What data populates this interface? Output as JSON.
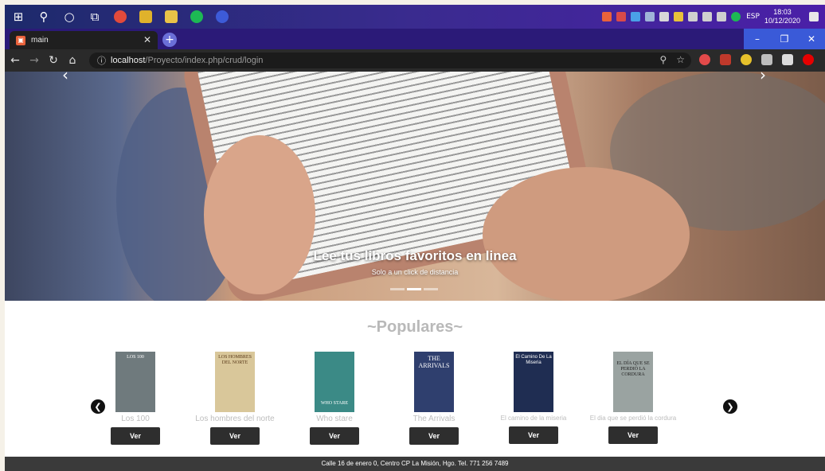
{
  "taskbar": {
    "clock_time": "18:03",
    "clock_date": "10/12/2020",
    "lang": "ESP",
    "icons": [
      "windows-start-icon",
      "search-icon",
      "cortana-icon",
      "task-view-icon",
      "chrome-icon",
      "among-us-icon",
      "file-explorer-icon",
      "spotify-icon",
      "browser-icon"
    ]
  },
  "browser": {
    "tab_title": "main",
    "url_host": "localhost",
    "url_path": "/Proyecto/index.php/crud/login"
  },
  "hero": {
    "title": "Lee tus libros favoritos en linea",
    "subtitle": "Solo a un click de distancia"
  },
  "populares": {
    "title": "~Populares~",
    "books": [
      {
        "title": "Los 100",
        "cover_color": "#6f7a7d",
        "cover_text": "LOS 100",
        "button": "Ver"
      },
      {
        "title": "Los hombres del norte",
        "cover_color": "#d9c79a",
        "cover_text": "LOS HOMBRES DEL NORTE",
        "button": "Ver"
      },
      {
        "title": "Who stare",
        "cover_color": "#3b8a86",
        "cover_text": "WHO STARE",
        "button": "Ver"
      },
      {
        "title": "The Arrivals",
        "cover_color": "#2f3f6e",
        "cover_text": "THE ARRIVALS",
        "button": "Ver"
      },
      {
        "title": "El camino de la miseria",
        "cover_color": "#1f2d52",
        "cover_text": "El Camino De La Miseria",
        "button": "Ver"
      },
      {
        "title": "El dia que se perdió la cordura",
        "cover_color": "#9aa3a1",
        "cover_text": "EL DÍA QUE SE PERDIÓ LA CORDURA",
        "button": "Ver"
      }
    ]
  },
  "footer": {
    "text": "Calle 16 de enero 0, Centro CP La Misión, Hgo. Tel. 771 256 7489"
  }
}
